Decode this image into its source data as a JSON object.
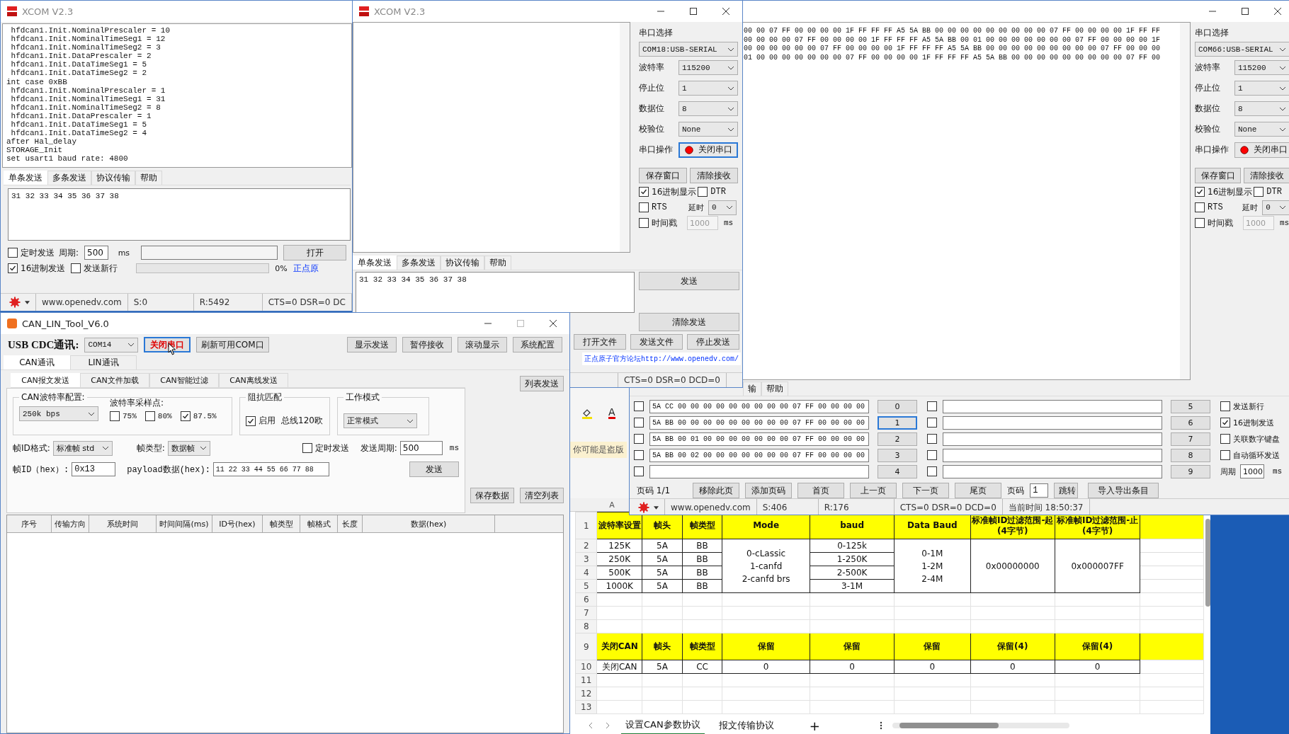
{
  "log_window": {
    "title": "XCOM V2.3",
    "receive_lines": [
      " hfdcan1.Init.NominalPrescaler = 10",
      " hfdcan1.Init.NominalTimeSeg1 = 12",
      " hfdcan1.Init.NominalTimeSeg2 = 3",
      " hfdcan1.Init.DataPrescaler = 2",
      " hfdcan1.Init.DataTimeSeg1 = 5",
      " hfdcan1.Init.DataTimeSeg2 = 2",
      "int case 0xBB",
      " hfdcan1.Init.NominalPrescaler = 1",
      " hfdcan1.Init.NominalTimeSeg1 = 31",
      " hfdcan1.Init.NominalTimeSeg2 = 8",
      " hfdcan1.Init.DataPrescaler = 1",
      " hfdcan1.Init.DataTimeSeg1 = 5",
      " hfdcan1.Init.DataTimeSeg2 = 4",
      "after Hal_delay",
      "STORAGE_Init",
      "set usart1 baud rate: 4800"
    ],
    "tabs": [
      {
        "label": "单条发送",
        "selected": true
      },
      {
        "label": "多条发送",
        "selected": false
      },
      {
        "label": "协议传输",
        "selected": false
      },
      {
        "label": "帮助",
        "selected": false
      }
    ],
    "send_text": "31 32 33 34 35 36 37 38",
    "timed_send": {
      "label": "定时发送",
      "checked": false
    },
    "period": {
      "label": "周期:",
      "value": "500",
      "unit": "ms"
    },
    "open_file_button": "打开",
    "hex_send": {
      "label": "16进制发送",
      "checked": true
    },
    "newline": {
      "label": "发送新行",
      "checked": false
    },
    "progress": {
      "level": 0,
      "reading": "0%"
    },
    "link": "正点原",
    "status": {
      "url": "www.openedv.com",
      "sent": "S:0",
      "received": "R:5492",
      "lines": "CTS=0 DSR=0 DC"
    }
  },
  "xcom_window": {
    "title": "XCOM V2.3",
    "panel": {
      "title": "串口选择",
      "port": "COM18:USB-SERIAL",
      "settings": [
        {
          "label": "波特率",
          "value": "115200"
        },
        {
          "label": "停止位",
          "value": "1"
        },
        {
          "label": "数据位",
          "value": "8"
        },
        {
          "label": "校验位",
          "value": "None"
        }
      ],
      "operation_label": "串口操作",
      "operation_button": "关闭串口",
      "port_open": true,
      "buttons": [
        "保存窗口",
        "清除接收"
      ],
      "hex_display": {
        "label": "16进制显示",
        "checked": true
      },
      "dtr": {
        "label": "DTR",
        "checked": false
      },
      "rts": {
        "label": "RTS",
        "checked": false
      },
      "delay": {
        "label": "延时",
        "value": "0"
      },
      "timestamp": {
        "label": "时间戳",
        "checked": false,
        "interval": "1000",
        "unit": "ms"
      }
    },
    "tabs": [
      {
        "label": "单条发送",
        "selected": true
      },
      {
        "label": "多条发送",
        "selected": false
      },
      {
        "label": "协议传输",
        "selected": false
      },
      {
        "label": "帮助",
        "selected": false
      }
    ],
    "send_text": "31 32 33 34 35 36 37 38",
    "send_button": "发送",
    "clear_send_button": "清除发送",
    "file_buttons": [
      "打开文件",
      "发送文件",
      "停止发送"
    ],
    "link": "正点原子官方论坛http://www.openedv.com/",
    "status_lines": "CTS=0 DSR=0 DCD=0"
  },
  "background_window": {
    "hex_lines": [
      "00 00 07 FF 00 00 00 00 1F FF FF FF A5 5A BB 00 00 00 00 00 00 00 00 00 07 FF 00 00 00 00 1F FF FF",
      "00 00 00 00 07 FF 00 00 00 00 1F FF FF FF A5 5A BB 00 01 00 00 00 00 00 00 00 07 FF 00 00 00 00 1F",
      "00 00 00 00 00 00 07 FF 00 00 00 00 1F FF FF FF A5 5A BB 00 00 00 00 00 00 00 00 00 07 FF 00 00 00",
      "01 00 00 00 00 00 00 00 07 FF 00 00 00 00 1F FF FF FF A5 5A BB 00 00 00 00 00 00 00 00 00 07 FF 00"
    ],
    "panel": {
      "title": "串口选择",
      "port": "COM66:USB-SERIAL",
      "settings": [
        {
          "label": "波特率",
          "value": "115200"
        },
        {
          "label": "停止位",
          "value": "1"
        },
        {
          "label": "数据位",
          "value": "8"
        },
        {
          "label": "校验位",
          "value": "None"
        }
      ],
      "operation_label": "串口操作",
      "operation_button": "关闭串口",
      "port_open": true,
      "buttons": [
        "保存窗口",
        "清除接收"
      ],
      "hex_display": {
        "label": "16进制显示",
        "checked": true
      },
      "dtr": {
        "label": "DTR",
        "checked": false
      },
      "rts": {
        "label": "RTS",
        "checked": false
      },
      "delay": {
        "label": "延时",
        "value": "0"
      },
      "timestamp": {
        "label": "时间戳",
        "checked": false,
        "interval": "1000",
        "unit": "ms"
      }
    },
    "tabs": [
      {
        "label": "输",
        "selected": false
      },
      {
        "label": "帮助",
        "selected": false
      }
    ],
    "entries": [
      {
        "checked": false,
        "text": "5A CC 00 00 00 00 00 00 00 00 00 07 FF 00 00 00 00",
        "button": "0",
        "selected": false
      },
      {
        "checked": false,
        "text": "5A BB 00 00 00 00 00 00 00 00 00 07 FF 00 00 00 00",
        "button": "1",
        "selected": true
      },
      {
        "checked": false,
        "text": "5A BB 00 01 00 00 00 00 00 00 00 07 FF 00 00 00 00",
        "button": "2",
        "selected": false
      },
      {
        "checked": false,
        "text": "5A BB 00 02 00 00 00 00 00 00 00 07 FF 00 00 00 00",
        "button": "3",
        "selected": false
      },
      {
        "checked": false,
        "button": "4",
        "selected": false
      },
      {
        "checked": false,
        "button": "5",
        "selected": false
      },
      {
        "checked": false,
        "button": "6",
        "selected": false
      },
      {
        "checked": false,
        "button": "7",
        "selected": false
      },
      {
        "checked": false,
        "button": "8",
        "selected": false
      },
      {
        "checked": false,
        "button": "9",
        "selected": false
      }
    ],
    "options": [
      {
        "label": "发送新行",
        "checked": false
      },
      {
        "label": "16进制发送",
        "checked": true
      },
      {
        "label": "关联数字键盘",
        "checked": false
      },
      {
        "label": "自动循环发送",
        "checked": false
      }
    ],
    "period": {
      "label": "周期",
      "value": "1000",
      "unit": "ms"
    },
    "pager": {
      "page": "页码 1/1",
      "buttons": [
        "移除此页",
        "添加页码",
        "首页",
        "上一页",
        "下一页",
        "尾页"
      ],
      "goto_label": "页码",
      "goto_value": "1",
      "goto_button": "跳转",
      "import_button": "导入导出条目"
    },
    "status": {
      "url": "www.openedv.com",
      "sent": "S:406",
      "received": "R:176",
      "lines": "CTS=0 DSR=0 DCD=0",
      "time": "当前时间 18:50:37"
    }
  },
  "can_lin_window": {
    "title": "CAN_LIN_Tool_V6.0",
    "connection_label": "USB CDC通讯:",
    "port": "COM14",
    "close_port_button": "关闭串口",
    "refresh_button": "刷新可用COM口",
    "toolbar_buttons": [
      "显示发送",
      "暂停接收",
      "滚动显示",
      "系统配置"
    ],
    "tabs": [
      {
        "label": "CAN通讯",
        "selected": true
      },
      {
        "label": "LIN通讯",
        "selected": false
      }
    ],
    "subtabs": [
      {
        "label": "CAN报文发送",
        "selected": true
      },
      {
        "label": "CAN文件加载",
        "selected": false
      },
      {
        "label": "CAN智能过滤",
        "selected": false
      },
      {
        "label": "CAN离线发送",
        "selected": false
      }
    ],
    "list_send_button": "列表发送",
    "baud_group": {
      "title": "CAN波特率配置:",
      "value": "250k bps",
      "sample_label": "波特率采样点:",
      "sample_points": [
        {
          "label": "75%",
          "checked": false
        },
        {
          "label": "80%",
          "checked": false
        },
        {
          "label": "87.5%",
          "checked": true
        }
      ]
    },
    "termination_group": {
      "title": "阻抗匹配",
      "enable": {
        "label": "启用",
        "checked": true
      },
      "note": "总线120欧"
    },
    "mode_group": {
      "title": "工作模式",
      "value": "正常模式"
    },
    "frame_format": {
      "label": "帧ID格式:",
      "value": "标准帧 std"
    },
    "frame_type": {
      "label": "帧类型:",
      "value": "数据帧"
    },
    "timed_send": {
      "label": "定时发送",
      "checked": false
    },
    "send_period": {
      "label": "发送周期:",
      "value": "500",
      "unit": "ms"
    },
    "frame_id": {
      "label": "帧ID（hex）:",
      "value": "0x13"
    },
    "payload": {
      "label": "payload数据(hex):",
      "value": "11 22 33 44 55 66 77 88"
    },
    "send_button": "发送",
    "save_button": "保存数据",
    "clear_button": "清空列表",
    "table": {
      "columns": [
        "序号",
        "传输方向",
        "系统时间",
        "时间间隔(ms)",
        "ID号(hex)",
        "帧类型",
        "帧格式",
        "长度",
        "数据(hex)"
      ]
    }
  },
  "spreadsheet": {
    "notice": "你可能是盗版",
    "font_color_letter": "A",
    "column_letter": "A",
    "rows": [
      {
        "kind": "header",
        "number": "1",
        "cells": [
          "波特率设置",
          "帧头",
          "帧类型",
          "Mode",
          "baud",
          "Data Baud",
          "标准帧ID过滤范围-起(4字节)",
          "标准帧ID过滤范围-止(4字节)"
        ]
      },
      {
        "kind": "group",
        "numbers": [
          "2",
          "3",
          "4",
          "5"
        ],
        "columns": [
          {
            "cells": [
              "125K",
              "250K",
              "500K",
              "1000K"
            ]
          },
          {
            "cells": [
              "5A",
              "5A",
              "5A",
              "5A"
            ]
          },
          {
            "cells": [
              "BB",
              "BB",
              "BB",
              "BB"
            ]
          },
          {
            "merged": [
              "0-cLassic",
              "1-canfd",
              "2-canfd brs"
            ]
          },
          {
            "cells": [
              "0-125k",
              "1-250K",
              "2-500K",
              "3-1M"
            ]
          },
          {
            "merged": [
              "0-1M",
              "1-2M",
              "2-4M"
            ]
          },
          {
            "merged": [
              "0x00000000"
            ]
          },
          {
            "merged": [
              "0x000007FF"
            ]
          }
        ]
      },
      {
        "kind": "empty",
        "number": "6"
      },
      {
        "kind": "empty",
        "number": "7"
      },
      {
        "kind": "empty",
        "number": "8"
      },
      {
        "kind": "header",
        "number": "9",
        "cells": [
          "关闭CAN",
          "帧头",
          "帧类型",
          "保留",
          "保留",
          "保留",
          "保留(4)",
          "保留(4)"
        ]
      },
      {
        "kind": "data",
        "number": "10",
        "cells": [
          "关闭CAN",
          "5A",
          "CC",
          "0",
          "0",
          "0",
          "0",
          "0"
        ]
      },
      {
        "kind": "empty",
        "number": "11"
      },
      {
        "kind": "empty",
        "number": "12"
      },
      {
        "kind": "empty",
        "number": "13"
      }
    ],
    "sheet_tabs": [
      {
        "label": "设置CAN参数协议",
        "selected": true
      },
      {
        "label": "报文传输协议",
        "selected": false
      }
    ],
    "add_sheet": "+"
  }
}
